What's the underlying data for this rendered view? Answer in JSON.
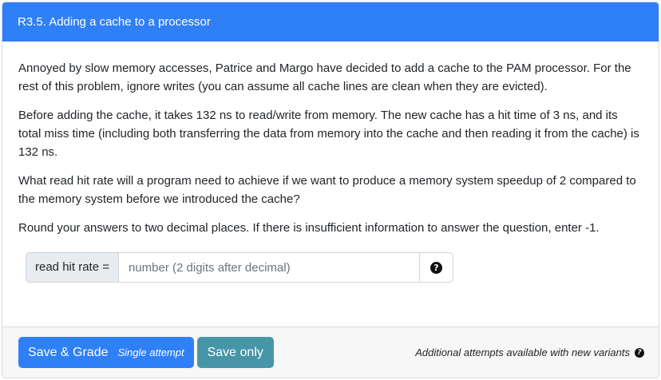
{
  "header": {
    "title": "R3.5. Adding a cache to a processor"
  },
  "body": {
    "paragraphs": [
      "Annoyed by slow memory accesses, Patrice and Margo have decided to add a cache to the PAM processor. For the rest of this problem, ignore writes (you can assume all cache lines are clean when they are evicted).",
      "Before adding the cache, it takes 132 ns to read/write from memory. The new cache has a hit time of 3 ns, and its total miss time (including both transferring the data from memory into the cache and then reading it from the cache) is 132 ns.",
      "What read hit rate will a program need to achieve if we want to produce a memory system speedup of 2 compared to the memory system before we introduced the cache?",
      "Round your answers to two decimal places. If there is insufficient information to answer the question, enter -1."
    ]
  },
  "answer": {
    "label": "read hit rate =",
    "value": "",
    "placeholder": "number (2 digits after decimal)",
    "help_icon": "question-circle-icon"
  },
  "footer": {
    "save_grade_label": "Save & Grade",
    "save_grade_sub": "Single attempt",
    "save_only_label": "Save only",
    "note": "Additional attempts available with new variants",
    "note_icon": "question-circle-icon"
  },
  "colors": {
    "header_bg": "#2f7ff7",
    "primary": "#2f7ff7",
    "secondary": "#4696a8"
  }
}
